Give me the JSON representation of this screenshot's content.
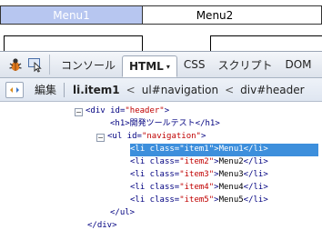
{
  "page": {
    "nav": [
      {
        "label": "Menu1"
      },
      {
        "label": "Menu2"
      }
    ]
  },
  "toolbar": {
    "tabs": [
      {
        "label": "コンソール"
      },
      {
        "label": "HTML",
        "caret": "▾"
      },
      {
        "label": "CSS"
      },
      {
        "label": "スクリプト"
      },
      {
        "label": "DOM"
      }
    ]
  },
  "crumbs": {
    "edit_label": "編集",
    "items": [
      {
        "label": "li.item1"
      },
      {
        "label": "ul#navigation"
      },
      {
        "label": "div#header"
      }
    ],
    "separator": "<"
  },
  "tree": {
    "div_open": {
      "tag": "<div",
      "attr": " id=",
      "val": "\"header\"",
      "end": ">"
    },
    "h1": {
      "text": "<h1>開発ツールテスト</h1>"
    },
    "ul_open": {
      "tag": "<ul",
      "attr": " id=",
      "val": "\"navigation\"",
      "end": ">"
    },
    "items": [
      {
        "tag": "<li",
        "attr": " class=",
        "val": "\"item1\"",
        "mid": ">",
        "text": "Menu1",
        "end": "</li>"
      },
      {
        "tag": "<li",
        "attr": " class=",
        "val": "\"item2\"",
        "mid": ">",
        "text": "Menu2",
        "end": "</li>"
      },
      {
        "tag": "<li",
        "attr": " class=",
        "val": "\"item3\"",
        "mid": ">",
        "text": "Menu3",
        "end": "</li>"
      },
      {
        "tag": "<li",
        "attr": " class=",
        "val": "\"item4\"",
        "mid": ">",
        "text": "Menu4",
        "end": "</li>"
      },
      {
        "tag": "<li",
        "attr": " class=",
        "val": "\"item5\"",
        "mid": ">",
        "text": "Menu5",
        "end": "</li>"
      }
    ],
    "ul_close": "</ul>",
    "div_close": "</div>",
    "twisty_open": "−"
  },
  "colors": {
    "selected": "#3d8fdc",
    "menu_highlight": "#b7c6f0"
  }
}
